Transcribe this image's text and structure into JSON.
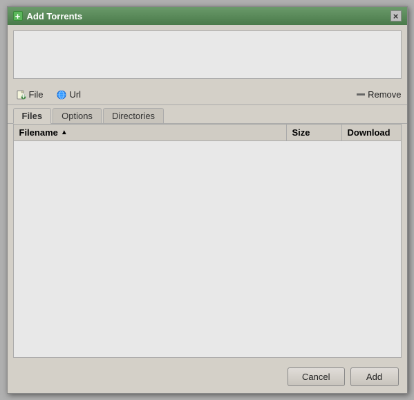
{
  "dialog": {
    "title": "Add Torrents",
    "close_label": "×",
    "title_icon": "+"
  },
  "toolbar": {
    "file_btn_label": "File",
    "url_btn_label": "Url",
    "remove_btn_label": "Remove"
  },
  "tabs": [
    {
      "label": "Files",
      "active": true
    },
    {
      "label": "Options",
      "active": false
    },
    {
      "label": "Directories",
      "active": false
    }
  ],
  "table": {
    "col_filename": "Filename",
    "col_size": "Size",
    "col_download": "Download",
    "sort_indicator": "▲"
  },
  "buttons": {
    "cancel_label": "Cancel",
    "add_label": "Add"
  }
}
